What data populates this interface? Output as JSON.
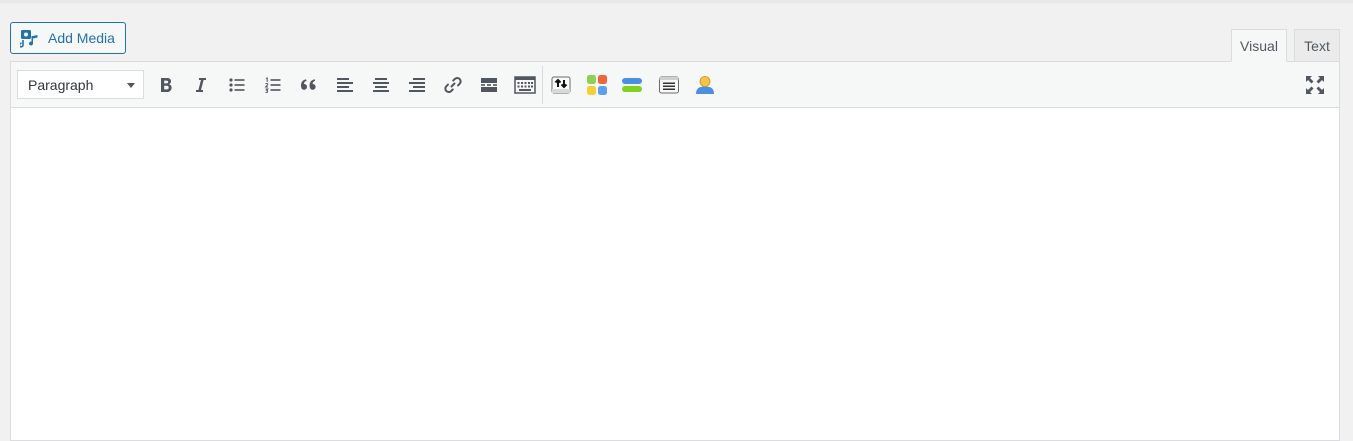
{
  "media": {
    "add_media_label": "Add Media",
    "icon": "add-media-icon"
  },
  "tabs": [
    {
      "label": "Visual",
      "active": true
    },
    {
      "label": "Text",
      "active": false
    }
  ],
  "toolbar": {
    "format_value": "Paragraph",
    "buttons": [
      "bold-icon",
      "italic-icon",
      "bulleted-list-icon",
      "numbered-list-icon",
      "blockquote-icon",
      "align-left-icon",
      "align-center-icon",
      "align-right-icon",
      "link-icon",
      "read-more-icon",
      "toolbar-toggle-icon",
      "insert-shortcode-icon",
      "widgets-icon",
      "layout-icon",
      "contact-form-icon",
      "author-box-icon",
      "fullscreen-icon"
    ]
  },
  "colors": {
    "accent": "#2271b1",
    "icon": "#50575e",
    "toolbar_bg": "#f6f7f7",
    "page_bg": "#f1f1f1"
  }
}
